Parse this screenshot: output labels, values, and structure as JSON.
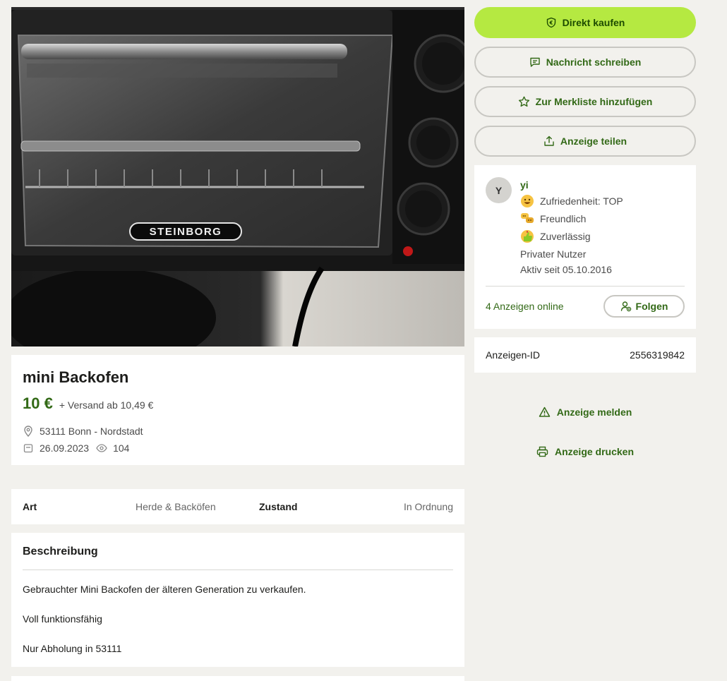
{
  "listing": {
    "image_alt": "Steinborg mini oven photo",
    "brand_on_photo": "STEINBORG",
    "title": "mini Backofen",
    "price": "10 €",
    "shipping": "+ Versand ab 10,49 €",
    "location": "53111 Bonn - Nordstadt",
    "date": "26.09.2023",
    "views": "104"
  },
  "details": {
    "art_label": "Art",
    "art_value": "Herde & Backöfen",
    "zustand_label": "Zustand",
    "zustand_value": "In Ordnung"
  },
  "description": {
    "heading": "Beschreibung",
    "line1": "Gebrauchter Mini Backofen der älteren Generation zu verkaufen.",
    "line2": "Voll funktionsfähig",
    "line3": "Nur Abholung in 53111"
  },
  "actions": {
    "buy": "Direkt kaufen",
    "message": "Nachricht schreiben",
    "watchlist": "Zur Merkliste hinzufügen",
    "share": "Anzeige teilen"
  },
  "seller": {
    "initial": "Y",
    "name": "yi",
    "badges": [
      "Zufriedenheit: TOP",
      "Freundlich",
      "Zuverlässig"
    ],
    "type": "Privater Nutzer",
    "active_since": "Aktiv seit 05.10.2016",
    "ads_online": "4 Anzeigen online",
    "follow": "Folgen"
  },
  "ad_id": {
    "label": "Anzeigen-ID",
    "value": "2556319842"
  },
  "links": {
    "report": "Anzeige melden",
    "print": "Anzeige drucken"
  },
  "colors": {
    "accent_green": "#326916",
    "primary_button": "#b5e941",
    "background": "#f2f1ed"
  },
  "icons": {
    "buy": "shield-euro-icon",
    "message": "chat-bubble-icon",
    "watchlist": "star-icon",
    "share": "share-upload-icon",
    "location": "map-pin-icon",
    "date": "calendar-icon",
    "views": "eye-icon",
    "follow": "user-follow-icon",
    "report": "warning-triangle-icon",
    "print": "printer-icon"
  }
}
